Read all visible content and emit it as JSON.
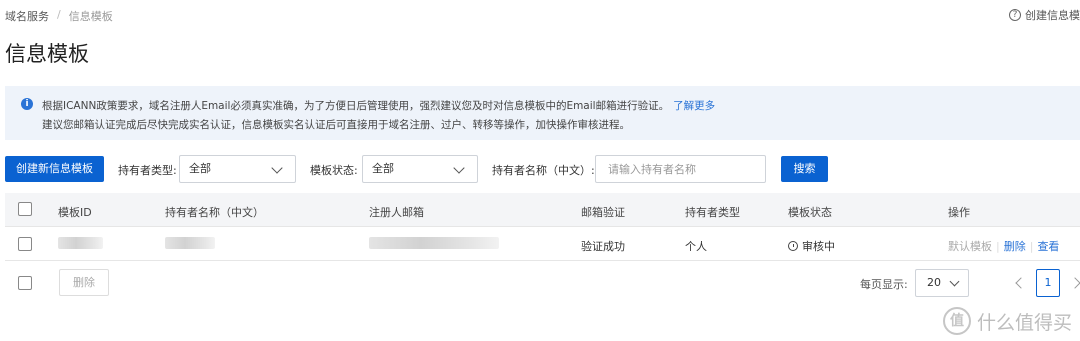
{
  "breadcrumb": {
    "items": [
      "域名服务",
      "信息模板"
    ],
    "separator": "/"
  },
  "header": {
    "title": "信息模板",
    "help_icon": "?",
    "help_link": "创建信息模"
  },
  "notice": {
    "icon": "i",
    "line1": "根据ICANN政策要求，域名注册人Email必须真实准确，为了方便日后管理使用，强烈建议您及时对信息模板中的Email邮箱进行验证。",
    "line1_link": "了解更多",
    "line2": "建议您邮箱认证完成后尽快完成实名认证，信息模板实名认证后可直接用于域名注册、过户、转移等操作，加快操作审核进程。"
  },
  "toolbar": {
    "create_label": "创建新信息模板",
    "holder_type_label": "持有者类型:",
    "holder_type_value": "全部",
    "template_status_label": "模板状态:",
    "template_status_value": "全部",
    "holder_name_label": "持有者名称（中文）:",
    "holder_name_placeholder": "请输入持有者名称",
    "search_label": "搜索"
  },
  "table": {
    "columns": [
      "模板ID",
      "持有者名称（中文）",
      "注册人邮箱",
      "邮箱验证",
      "持有者类型",
      "模板状态",
      "操作"
    ],
    "rows": [
      {
        "email_verify": "验证成功",
        "holder_type": "个人",
        "status": "审核中",
        "actions": [
          "默认模板",
          "删除",
          "查看"
        ]
      }
    ]
  },
  "footer": {
    "delete_label": "删除",
    "page_size_label": "每页显示:",
    "page_size": "20",
    "current_page": "1"
  },
  "watermark": {
    "icon": "值",
    "text": "什么值得买"
  },
  "colors": {
    "primary": "#0a62d1",
    "link": "#2a73d6",
    "notice_bg": "#eef3fa",
    "header_bg": "#f4f5f7"
  }
}
